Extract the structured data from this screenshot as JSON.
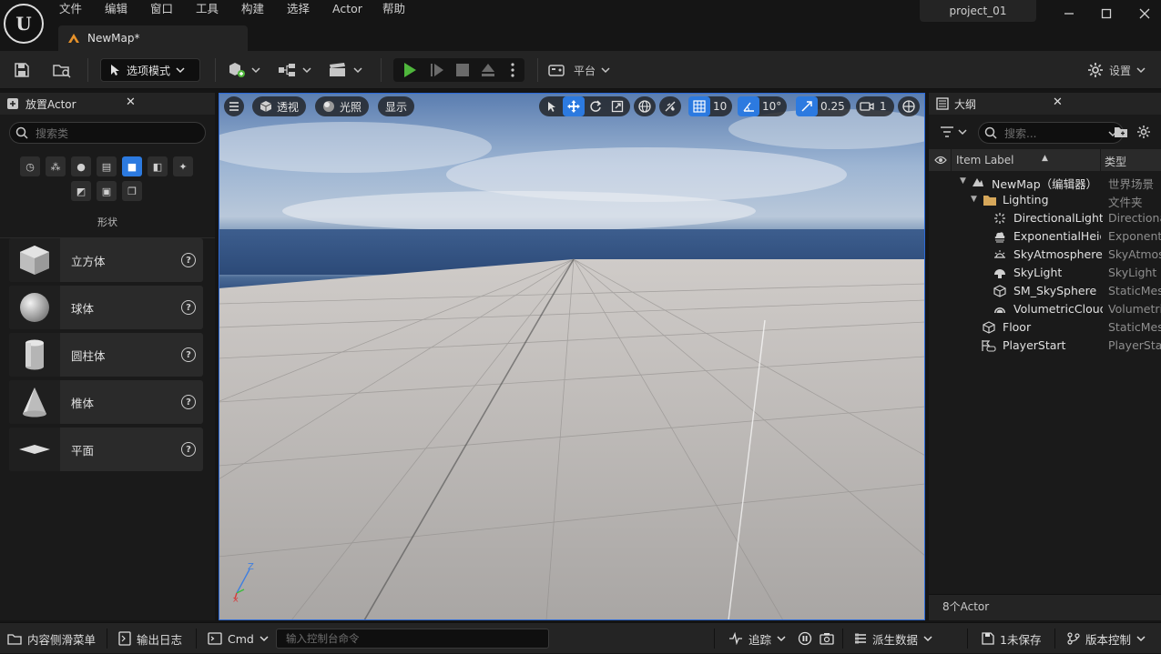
{
  "window": {
    "project_name": "project_01",
    "doc_tab": "NewMap*",
    "menu": [
      "文件",
      "编辑",
      "窗口",
      "工具",
      "构建",
      "选择",
      "Actor",
      "帮助"
    ]
  },
  "toolbar": {
    "mode_label": "选项模式",
    "platform_label": "平台",
    "settings_label": "设置"
  },
  "place_actor": {
    "title": "放置Actor",
    "search_placeholder": "搜索类",
    "category_label": "形状",
    "items": [
      {
        "label": "立方体"
      },
      {
        "label": "球体"
      },
      {
        "label": "圆柱体"
      },
      {
        "label": "椎体"
      },
      {
        "label": "平面"
      }
    ]
  },
  "viewport": {
    "perspective": "透视",
    "lighting": "光照",
    "show": "显示",
    "grid_snap": "10",
    "rotation_snap": "10°",
    "scale_snap": "0.25",
    "camera_speed": "1",
    "axis_z": "Z"
  },
  "outliner": {
    "title": "大纲",
    "search_placeholder": "搜索...",
    "col_label": "Item Label",
    "col_type": "类型",
    "rows": [
      {
        "name": "NewMap（编辑器）",
        "type": "世界场景",
        "indent": 0
      },
      {
        "name": "Lighting",
        "type": "文件夹",
        "indent": 1
      },
      {
        "name": "DirectionalLight",
        "type": "DirectionalLight",
        "indent": 2
      },
      {
        "name": "ExponentialHeightFog",
        "type": "ExponentialHeightFog",
        "indent": 2
      },
      {
        "name": "SkyAtmosphere",
        "type": "SkyAtmosphere",
        "indent": 2
      },
      {
        "name": "SkyLight",
        "type": "SkyLight",
        "indent": 2
      },
      {
        "name": "SM_SkySphere",
        "type": "StaticMeshActor",
        "indent": 2
      },
      {
        "name": "VolumetricCloud",
        "type": "VolumetricCloud",
        "indent": 2
      },
      {
        "name": "Floor",
        "type": "StaticMeshActor",
        "indent": 1
      },
      {
        "name": "PlayerStart",
        "type": "PlayerStart",
        "indent": 1
      }
    ],
    "footer": "8个Actor"
  },
  "statusbar": {
    "content_drawer": "内容侧滑菜单",
    "output_log": "输出日志",
    "cmd": "Cmd",
    "cmd_placeholder": "输入控制台命令",
    "trace": "追踪",
    "derived_data": "派生数据",
    "unsaved": "1未保存",
    "source_control": "版本控制"
  },
  "colors": {
    "accent": "#2c7ae0",
    "play": "#4fb63c",
    "panel": "#1a1a1a"
  }
}
